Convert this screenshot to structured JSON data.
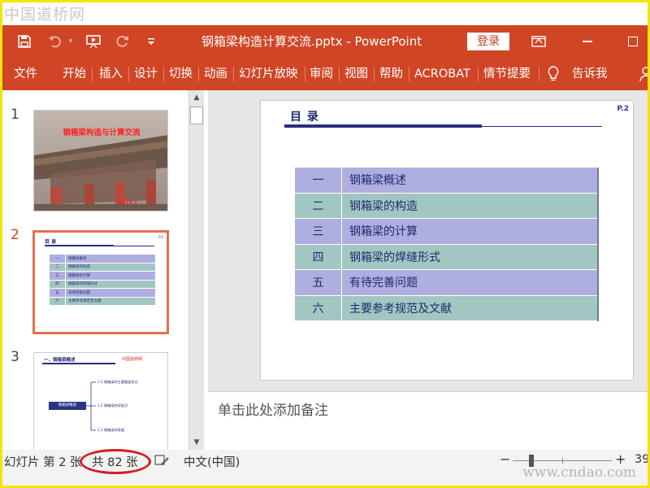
{
  "watermark": {
    "top": "中国道桥网",
    "bottom": "www.cndao.com"
  },
  "titlebar": {
    "doc_title": "钢箱梁构造计算交流.pptx  -  PowerPoint",
    "login_label": "登录",
    "icons": [
      "save-icon",
      "undo-icon",
      "slideshow-from-start-icon",
      "redo-icon",
      "customize-qat-icon",
      "ribbon-display-icon",
      "minimize-icon",
      "maximize-icon"
    ],
    "accent": "#d04525"
  },
  "ribbon": {
    "tabs": [
      "文件",
      "开始",
      "插入",
      "设计",
      "切换",
      "动画",
      "幻灯片放映",
      "审阅",
      "视图",
      "帮助",
      "ACROBAT",
      "情节提要"
    ],
    "tell_me": "告诉我"
  },
  "thumbnails": [
    {
      "number": "1",
      "title": "钢箱梁构造与计算交流",
      "footer": "2016.1"
    },
    {
      "number": "2",
      "heading": "目  录",
      "page": "P.2",
      "rows": [
        [
          "一",
          "钢箱梁概述"
        ],
        [
          "二",
          "钢箱梁的构造"
        ],
        [
          "三",
          "钢箱梁的计算"
        ],
        [
          "四",
          "钢箱梁的焊缝形式"
        ],
        [
          "五",
          "有待完善问题"
        ],
        [
          "六",
          "主要参考规范及文献"
        ]
      ]
    },
    {
      "number": "3",
      "heading": "一、钢箱梁概述",
      "tag": "中国道桥网",
      "box": "钢箱梁概述",
      "items": [
        "1.1 钢箱梁的主要截面形式",
        "1.2 钢箱梁的优缺点",
        "1.3 钢箱梁的发展"
      ]
    }
  ],
  "slide": {
    "heading": "目  录",
    "page": "P.2",
    "rows": [
      {
        "num": "一",
        "text": "钢箱梁概述"
      },
      {
        "num": "二",
        "text": "钢箱梁的构造"
      },
      {
        "num": "三",
        "text": "钢箱梁的计算"
      },
      {
        "num": "四",
        "text": "钢箱梁的焊缝形式"
      },
      {
        "num": "五",
        "text": "有待完善问题"
      },
      {
        "num": "六",
        "text": "主要参考规范及文献"
      }
    ],
    "row_colors": [
      "#aeaee0",
      "#a2c6c2"
    ]
  },
  "notes": {
    "placeholder": "单击此处添加备注"
  },
  "status": {
    "slide_pos": "幻灯片 第 2 张",
    "slide_total": "共 82 张",
    "language": "中文(中国)",
    "zoom_minus": "−",
    "zoom_plus": "+",
    "zoom_value": "39"
  }
}
